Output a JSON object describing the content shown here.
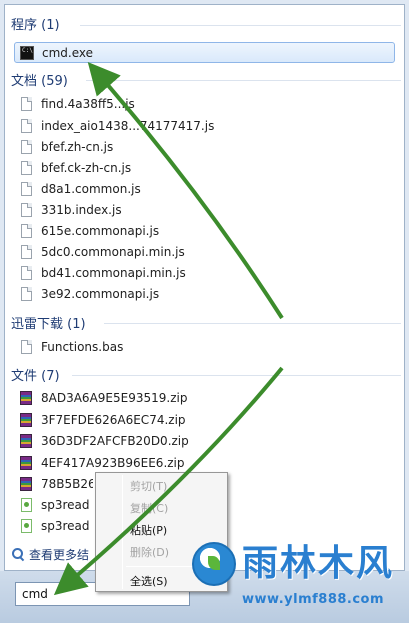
{
  "sections": {
    "programs": {
      "title": "程序 (1)",
      "items": [
        {
          "label": "cmd.exe",
          "icon": "cmd-icon"
        }
      ]
    },
    "documents": {
      "title": "文档 (59)",
      "items": [
        {
          "label": "find.4a38ff5...js",
          "icon": "document-icon"
        },
        {
          "label": "index_aio1438...74177417.js",
          "icon": "document-icon"
        },
        {
          "label": "bfef.zh-cn.js",
          "icon": "document-icon"
        },
        {
          "label": "bfef.ck-zh-cn.js",
          "icon": "document-icon"
        },
        {
          "label": "d8a1.common.js",
          "icon": "document-icon"
        },
        {
          "label": "331b.index.js",
          "icon": "document-icon"
        },
        {
          "label": "615e.commonapi.js",
          "icon": "document-icon"
        },
        {
          "label": "5dc0.commonapi.min.js",
          "icon": "document-icon"
        },
        {
          "label": "bd41.commonapi.min.js",
          "icon": "document-icon"
        },
        {
          "label": "3e92.commonapi.js",
          "icon": "document-icon"
        }
      ]
    },
    "downloads": {
      "title": "迅雷下载 (1)",
      "items": [
        {
          "label": "Functions.bas",
          "icon": "document-icon"
        }
      ]
    },
    "files": {
      "title": "文件 (7)",
      "items": [
        {
          "label": "8AD3A6A9E5E93519.zip",
          "icon": "archive-icon"
        },
        {
          "label": "3F7EFDE626A6EC74.zip",
          "icon": "archive-icon"
        },
        {
          "label": "36D3DF2AFCFB20D0.zip",
          "icon": "archive-icon"
        },
        {
          "label": "4EF417A923B96EE6.zip",
          "icon": "archive-icon"
        },
        {
          "label": "78B5B26",
          "icon": "archive-icon"
        },
        {
          "label": "sp3read",
          "icon": "text-file-icon"
        },
        {
          "label": "sp3read",
          "icon": "text-file-icon"
        }
      ]
    }
  },
  "see_more": "查看更多结",
  "search": {
    "value": "cmd"
  },
  "context_menu": {
    "items": [
      {
        "label": "剪切(T)",
        "enabled": false
      },
      {
        "label": "复制(C)",
        "enabled": false
      },
      {
        "label": "粘贴(P)",
        "enabled": true
      },
      {
        "label": "删除(D)",
        "enabled": false
      },
      {
        "label": "全选(S)",
        "enabled": true
      }
    ]
  },
  "watermark": {
    "title": "雨林木风",
    "url": "www.ylmf888.com"
  },
  "colors": {
    "section_title": "#1e3b73",
    "arrow": "#3c8c2c",
    "watermark": "#2a7fd0",
    "selection_border": "#8fb6e8"
  }
}
